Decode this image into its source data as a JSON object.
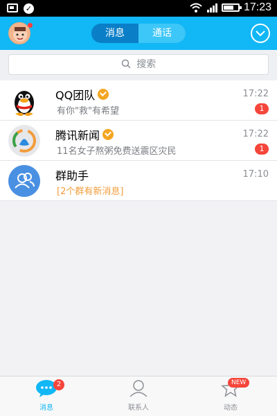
{
  "status_bar": {
    "time": "17:23"
  },
  "header": {
    "tabs": [
      {
        "label": "消息",
        "active": true
      },
      {
        "label": "通话",
        "active": false
      }
    ]
  },
  "search": {
    "placeholder": "搜索"
  },
  "conversations": [
    {
      "title": "QQ团队",
      "time": "17:22",
      "preview": "有你\"救\"有希望",
      "unread": "1",
      "verified": true
    },
    {
      "title": "腾讯新闻",
      "time": "17:22",
      "preview": "11名女子熬粥免费送震区灾民",
      "unread": "1",
      "verified": true
    },
    {
      "title": "群助手",
      "time": "17:10",
      "preview": "[2个群有新消息]",
      "unread": "",
      "verified": false
    }
  ],
  "bottom_nav": {
    "items": [
      {
        "label": "消息",
        "badge": "2",
        "active": true
      },
      {
        "label": "联系人",
        "badge": "",
        "active": false
      },
      {
        "label": "动态",
        "badge": "NEW",
        "active": false
      }
    ]
  },
  "colors": {
    "brand_blue": "#12b7f5",
    "badge_red": "#f5463b",
    "verified_orange": "#f4a623",
    "link_orange": "#f39c3b"
  }
}
